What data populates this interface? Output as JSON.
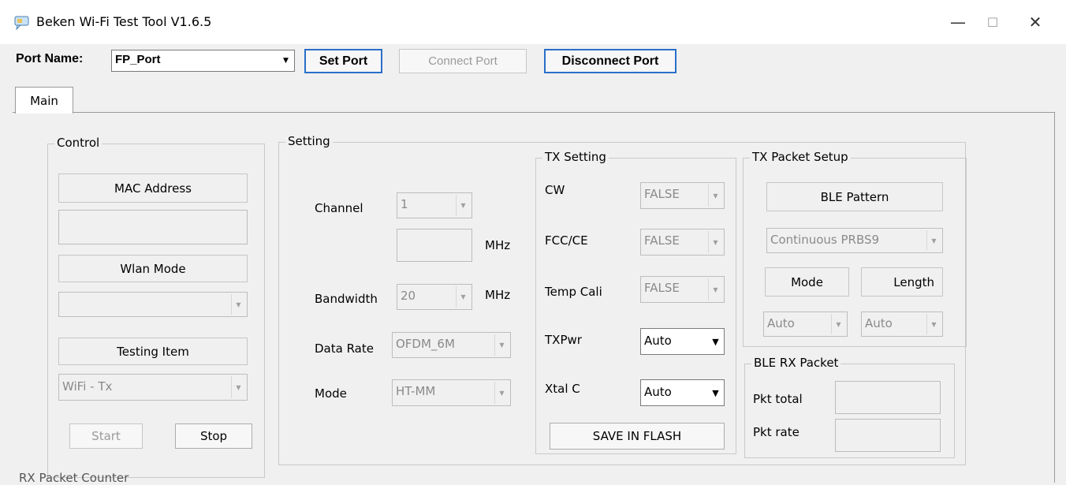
{
  "window": {
    "title": "Beken Wi-Fi Test Tool V1.6.5",
    "minimize_glyph": "—",
    "maximize_glyph": "☐",
    "close_glyph": "✕"
  },
  "port": {
    "label": "Port Name:",
    "selected": "FP_Port",
    "set_label": "Set Port",
    "connect_label": "Connect Port",
    "disconnect_label": "Disconnect Port"
  },
  "tabs": [
    {
      "label": "Main"
    }
  ],
  "control": {
    "title": "Control",
    "mac_label": "MAC Address",
    "mac_value": "",
    "wlan_label": "Wlan Mode",
    "wlan_value": "",
    "testing_label": "Testing Item",
    "testing_value": "WiFi - Tx",
    "start_label": "Start",
    "stop_label": "Stop"
  },
  "setting": {
    "title": "Setting",
    "channel_label": "Channel",
    "channel_value": "1",
    "freq_value": "",
    "freq_unit": "MHz",
    "bandwidth_label": "Bandwidth",
    "bandwidth_value": "20",
    "bandwidth_unit": "MHz",
    "datarate_label": "Data Rate",
    "datarate_value": "OFDM_6M",
    "mode_label": "Mode",
    "mode_value": "HT-MM"
  },
  "tx_setting": {
    "title": "TX Setting",
    "cw_label": "CW",
    "cw_value": "FALSE",
    "fcc_label": "FCC/CE",
    "fcc_value": "FALSE",
    "tempcali_label": "Temp Cali",
    "tempcali_value": "FALSE",
    "txpwr_label": "TXPwr",
    "txpwr_value": "Auto",
    "xtal_label": "Xtal C",
    "xtal_value": "Auto",
    "save_label": "SAVE IN FLASH"
  },
  "tx_packet": {
    "title": "TX Packet Setup",
    "ble_pattern_label": "BLE Pattern",
    "ble_pattern_value": "Continuous PRBS9",
    "mode_label": "Mode",
    "length_label": "Length",
    "mode_value": "Auto",
    "length_value": "Auto"
  },
  "ble_rx": {
    "title": "BLE RX Packet",
    "pkt_total_label": "Pkt total",
    "pkt_total_value": "",
    "pkt_rate_label": "Pkt rate",
    "pkt_rate_value": ""
  },
  "bottom_partial": {
    "label": "RX Packet Counter"
  },
  "icons": {
    "app": "chat-bubble-icon",
    "combo_arrow": "▼"
  }
}
